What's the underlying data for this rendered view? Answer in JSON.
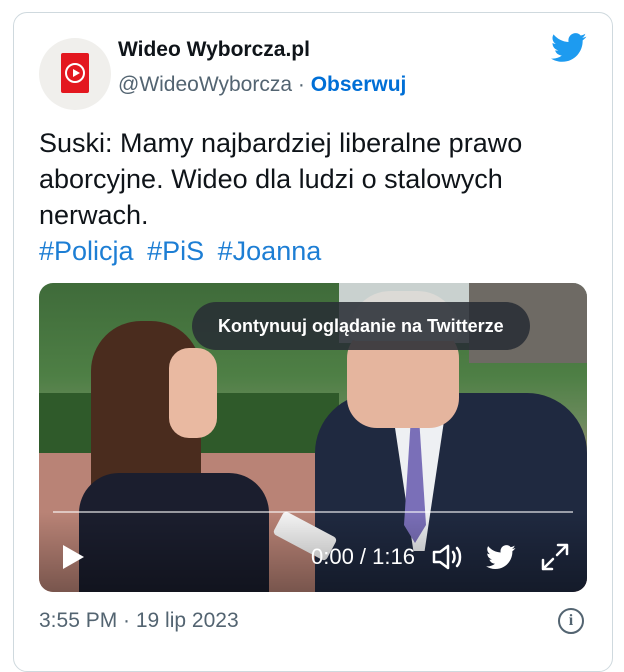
{
  "account": {
    "name": "Wideo Wyborcza.pl",
    "handle": "@WideoWyborcza",
    "separator": "·",
    "follow_label": "Obserwuj",
    "avatar_icon": "wideo-wyborcza-logo-icon",
    "brand_color": "#e3171f"
  },
  "platform_icon": "twitter-bird-icon",
  "tweet": {
    "text": "Suski: Mamy najbardziej liberalne prawo aborcyjne. Wideo dla ludzi o stalowych nerwach.",
    "hashtags": [
      "#Policja",
      "#PiS",
      "#Joanna"
    ]
  },
  "video": {
    "continue_label": "Kontynuuj oglądanie na Twitterze",
    "time": "0:00 / 1:16",
    "progress": 0,
    "controls": [
      "play-icon",
      "volume-icon",
      "twitter-bird-icon",
      "expand-icon"
    ]
  },
  "footer": {
    "timestamp": "3:55 PM · 19 lip 2023",
    "info_icon": "info-icon",
    "info_glyph": "i"
  },
  "colors": {
    "link": "#1d7ed4",
    "follow": "#006fd6",
    "secondary_text": "#536471",
    "twitter_blue": "#1d9bf0"
  }
}
